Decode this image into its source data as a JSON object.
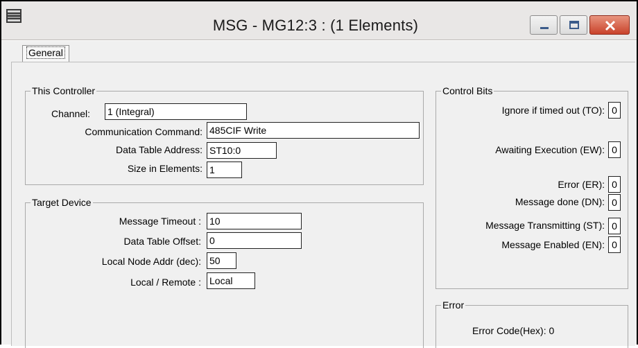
{
  "window": {
    "title": "MSG - MG12:3 : (1 Elements)"
  },
  "tabs": [
    {
      "label": "General",
      "selected": true
    }
  ],
  "this_controller": {
    "title": "This Controller",
    "channel_label": "Channel:",
    "channel_value": "1 (Integral)",
    "comm_command_label": "Communication Command:",
    "comm_command_value": "485CIF Write",
    "data_table_address_label": "Data Table Address:",
    "data_table_address_value": "ST10:0",
    "size_label": "Size in Elements:",
    "size_value": "1"
  },
  "target_device": {
    "title": "Target Device",
    "timeout_label": "Message Timeout :",
    "timeout_value": "10",
    "offset_label": "Data Table Offset:",
    "offset_value": "0",
    "node_label": "Local Node Addr (dec):",
    "node_value": "50",
    "local_remote_label": "Local / Remote :",
    "local_remote_value": "Local"
  },
  "control_bits": {
    "title": "Control Bits",
    "bits": [
      {
        "label": "Ignore if timed out (TO):",
        "value": "0"
      },
      {
        "label": "Awaiting Execution (EW):",
        "value": "0"
      },
      {
        "label": "Error (ER):",
        "value": "0"
      },
      {
        "label": "Message done (DN):",
        "value": "0"
      },
      {
        "label": "Message Transmitting (ST):",
        "value": "0"
      },
      {
        "label": "Message Enabled (EN):",
        "value": "0"
      }
    ]
  },
  "error": {
    "title": "Error",
    "code_label": "Error Code(Hex):",
    "code_value": "0"
  },
  "colors": {
    "titlebar": "#e9e7e6",
    "client": "#f0f0f0",
    "close_button": "#c9422a"
  },
  "icons": [
    "app-icon",
    "minimize-icon",
    "maximize-icon",
    "close-icon"
  ]
}
